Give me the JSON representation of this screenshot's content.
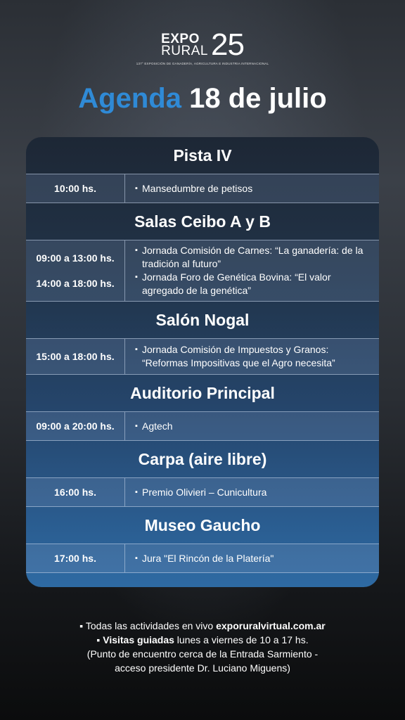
{
  "logo": {
    "line1": "EXPO",
    "line2": "RURAL",
    "number": "25",
    "subtitle": "137° EXPOSICIÓN DE GANADERÍA, AGRICULTURA E INDUSTRIA INTERNACIONAL"
  },
  "title": {
    "accent": "Agenda",
    "rest": "18 de julio"
  },
  "sections": [
    {
      "name": "Pista IV",
      "times": [
        "10:00 hs."
      ],
      "items": [
        "Mansedumbre de petisos"
      ]
    },
    {
      "name": "Salas Ceibo A y B",
      "times": [
        "09:00 a 13:00 hs.",
        "14:00 a 18:00 hs."
      ],
      "items": [
        "Jornada Comisión de Carnes: “La ganadería: de la tradición al futuro”",
        "Jornada Foro de Genética Bovina: “El valor agregado de la genética”"
      ]
    },
    {
      "name": "Salón Nogal",
      "times": [
        "15:00 a 18:00 hs."
      ],
      "items": [
        "Jornada Comisión de Impuestos y Granos: “Reformas Impositivas que el Agro necesita”"
      ]
    },
    {
      "name": "Auditorio Principal",
      "times": [
        "09:00 a 20:00 hs."
      ],
      "items": [
        "Agtech"
      ]
    },
    {
      "name": "Carpa (aire libre)",
      "times": [
        "16:00 hs."
      ],
      "items": [
        "Premio Olivieri – Cunicultura"
      ]
    },
    {
      "name": "Museo Gaucho",
      "times": [
        "17:00 hs."
      ],
      "items": [
        "Jura \"El Rincón de la Platería\""
      ]
    }
  ],
  "footer": {
    "line1_pre": "▪ Todas las actividades en vivo ",
    "line1_bold": "exporuralvirtual.com.ar",
    "line2_bold": "▪ Visitas guiadas",
    "line2_rest": " lunes a viernes de 10 a 17 hs.",
    "line3": "(Punto de encuentro cerca de la Entrada Sarmiento -",
    "line4": "acceso presidente Dr. Luciano Miguens)"
  }
}
